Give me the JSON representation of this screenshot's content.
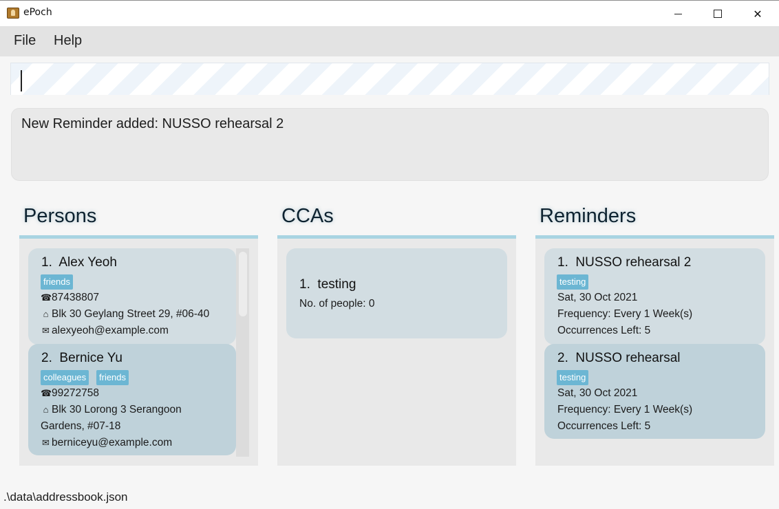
{
  "window": {
    "title": "ePoch",
    "minimize_icon": "minimize-icon",
    "maximize_icon": "maximize-icon",
    "close_glyph": "✕"
  },
  "menu": {
    "file": "File",
    "help": "Help"
  },
  "command": {
    "value": ""
  },
  "result": {
    "message": "New Reminder added: NUSSO rehearsal 2"
  },
  "persons": {
    "title": "Persons",
    "items": [
      {
        "index": "1.",
        "name": "Alex Yeoh",
        "tags": [
          "friends"
        ],
        "phone": "87438807",
        "address": "Blk 30 Geylang Street 29, #06-40",
        "address2": "",
        "email": "alexyeoh@example.com"
      },
      {
        "index": "2.",
        "name": "Bernice Yu",
        "tags": [
          "colleagues",
          "friends"
        ],
        "phone": "99272758",
        "address": "Blk 30 Lorong 3 Serangoon",
        "address2": "Gardens, #07-18",
        "email": "berniceyu@example.com"
      }
    ]
  },
  "ccas": {
    "title": "CCAs",
    "items": [
      {
        "index": "1.",
        "name": "testing",
        "people": "No. of people: 0"
      }
    ]
  },
  "reminders": {
    "title": "Reminders",
    "items": [
      {
        "index": "1.",
        "name": "NUSSO rehearsal 2",
        "tag": "testing",
        "date": "Sat, 30 Oct 2021",
        "frequency": "Frequency: Every 1 Week(s)",
        "occurrences": "Occurrences Left: 5"
      },
      {
        "index": "2.",
        "name": "NUSSO rehearsal",
        "tag": "testing",
        "date": "Sat, 30 Oct 2021",
        "frequency": "Frequency: Every 1 Week(s)",
        "occurrences": "Occurrences Left: 5"
      }
    ]
  },
  "status": {
    "path": ".\\data\\addressbook.json"
  },
  "icons": {
    "phone": "☎",
    "home": "⌂",
    "email": "✉"
  }
}
